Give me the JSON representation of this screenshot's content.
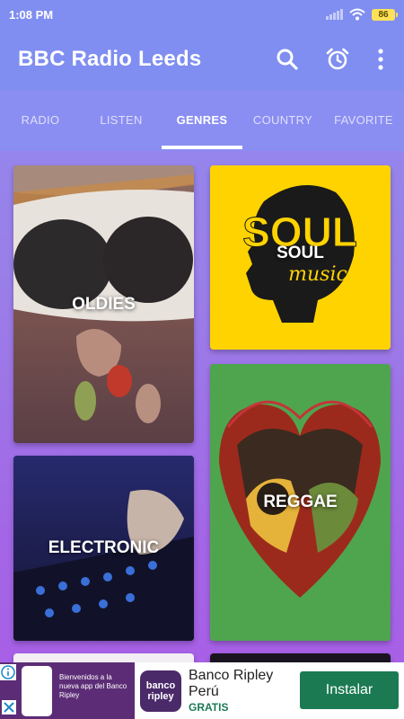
{
  "status_bar": {
    "time": "1:08 PM",
    "battery": "86"
  },
  "app_bar": {
    "title": "BBC Radio Leeds",
    "icons": [
      "search-icon",
      "alarm-clock-icon",
      "more-vert-icon"
    ]
  },
  "tabs": [
    {
      "label": "RADIO",
      "active": false
    },
    {
      "label": "LISTEN",
      "active": false
    },
    {
      "label": "GENRES",
      "active": true
    },
    {
      "label": "COUNTRY",
      "active": false
    },
    {
      "label": "FAVORITE",
      "active": false
    }
  ],
  "genres": [
    {
      "label": "OLDIES"
    },
    {
      "label": "SOUL"
    },
    {
      "label": "REGGAE"
    },
    {
      "label": "ELECTRONIC"
    }
  ],
  "soul_art": {
    "big_text": "SOUL",
    "script_text": "music"
  },
  "ad": {
    "thumb_text": "Bienvenidos a la nueva app del Banco Ripley",
    "logo_line1": "banco",
    "logo_line2": "ripley",
    "name": "Banco Ripley Perú",
    "sub": "GRATIS",
    "button": "Instalar"
  },
  "colors": {
    "app_bar": "#7f8ef0",
    "tabs": "#8a8ef2",
    "soul_bg": "#ffd300",
    "reggae_bg": "#4fa54e",
    "install_button": "#1b7a52"
  }
}
